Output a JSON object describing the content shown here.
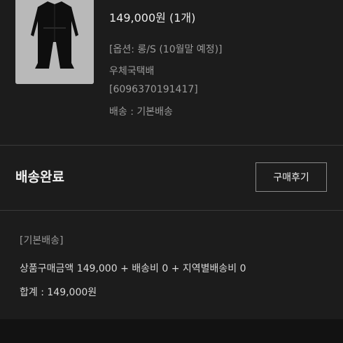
{
  "product": {
    "image_icon": "long-coat-image",
    "price_qty": "149,000원 (1개)",
    "option": "[옵션: 롱/S (10월말 예정)]",
    "courier": "우체국택배",
    "tracking": "[6096370191417]",
    "shipping_type": "배송 : 기본배송"
  },
  "status": {
    "title": "배송완료",
    "review_button": "구매후기"
  },
  "summary": {
    "shipping_type": "[기본배송]",
    "breakdown": "상품구매금액 149,000 + 배송비 0 + 지역별배송비 0",
    "total": "합계 : 149,000원"
  },
  "colors": {
    "background": "#1c1c1c",
    "thumbnail_bg": "#b9b9b9",
    "muted_text": "#9a9a9a"
  }
}
